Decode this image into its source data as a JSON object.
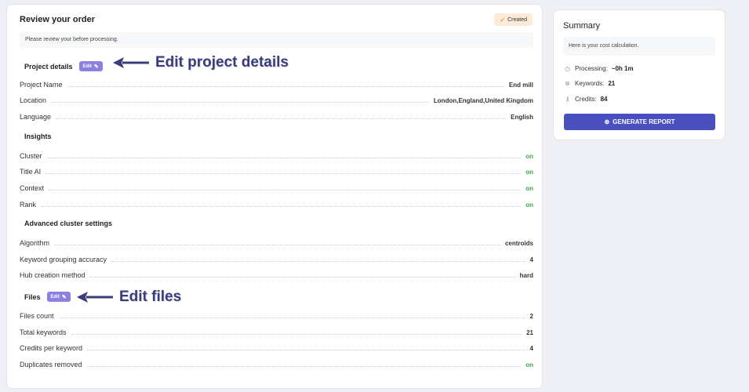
{
  "order": {
    "title": "Review your order",
    "status": "Created",
    "note": "Please review your before processing.",
    "project_details": {
      "heading": "Project details",
      "edit_label": "Edit",
      "rows": [
        {
          "label": "Project Name",
          "value": "End mill"
        },
        {
          "label": "Location",
          "value": "London,England,United Kingdom"
        },
        {
          "label": "Language",
          "value": "English"
        }
      ]
    },
    "insights": {
      "heading": "Insights",
      "rows": [
        {
          "label": "Cluster",
          "value": "on"
        },
        {
          "label": "Title AI",
          "value": "on"
        },
        {
          "label": "Context",
          "value": "on"
        },
        {
          "label": "Rank",
          "value": "on"
        }
      ]
    },
    "advanced": {
      "heading": "Advanced cluster settings",
      "rows": [
        {
          "label": "Algorithm",
          "value": "centroids"
        },
        {
          "label": "Keyword grouping accuracy",
          "value": "4"
        },
        {
          "label": "Hub creation method",
          "value": "hard"
        }
      ]
    },
    "files": {
      "heading": "Files",
      "edit_label": "Edit",
      "rows": [
        {
          "label": "Files count",
          "value": "2"
        },
        {
          "label": "Total keywords",
          "value": "21"
        },
        {
          "label": "Credits per keyword",
          "value": "4"
        },
        {
          "label": "Duplicates removed",
          "value": "on"
        }
      ]
    }
  },
  "annotations": {
    "edit_project": "Edit project details",
    "edit_files": "Edit files"
  },
  "summary": {
    "title": "Summary",
    "note": "Here is your cost calculation.",
    "processing_label": "Processing:",
    "processing_value": "~0h 1m",
    "keywords_label": "Keywords:",
    "keywords_value": "21",
    "credits_label": "Credits:",
    "credits_value": "84",
    "generate_label": "GENERATE REPORT"
  },
  "icons": {
    "status": "check-icon",
    "edit": "pencil-icon",
    "processing": "clock-icon",
    "keywords": "tag-icon",
    "credits": "key-icon",
    "generate": "plus-circle-icon"
  },
  "colors": {
    "accent": "#4a4fbf",
    "edit_button": "#8a80e0",
    "on": "#3ea44a",
    "annotation": "#3a3d7a",
    "badge_bg": "#fdebd7"
  }
}
